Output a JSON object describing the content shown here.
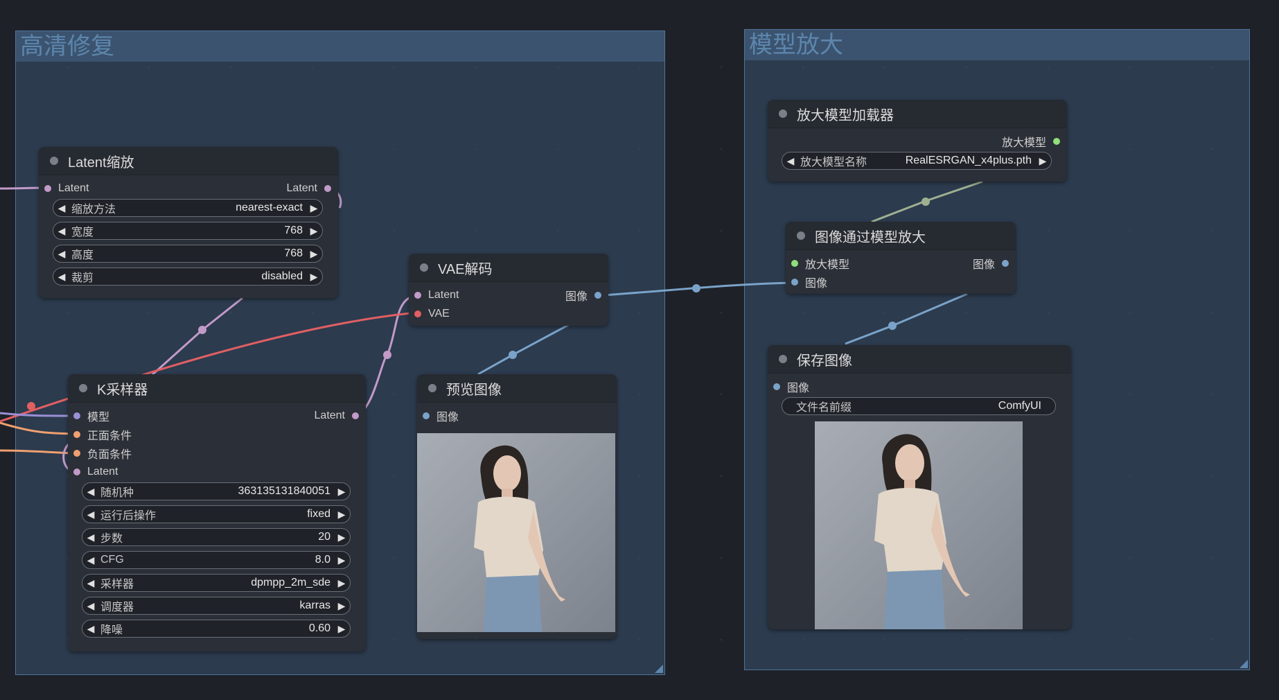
{
  "groups": {
    "hires": {
      "title": "高清修复"
    },
    "upscale": {
      "title": "模型放大"
    }
  },
  "latent_scale": {
    "title": "Latent缩放",
    "input": "Latent",
    "output": "Latent",
    "widgets": [
      {
        "label": "缩放方法",
        "value": "nearest-exact"
      },
      {
        "label": "宽度",
        "value": "768"
      },
      {
        "label": "高度",
        "value": "768"
      },
      {
        "label": "裁剪",
        "value": "disabled"
      }
    ]
  },
  "vae_decode": {
    "title": "VAE解码",
    "inputs": [
      "Latent",
      "VAE"
    ],
    "output": "图像"
  },
  "ksampler": {
    "title": "K采样器",
    "inputs": [
      "模型",
      "正面条件",
      "负面条件",
      "Latent"
    ],
    "output": "Latent",
    "widgets": [
      {
        "label": "随机种",
        "value": "363135131840051"
      },
      {
        "label": "运行后操作",
        "value": "fixed"
      },
      {
        "label": "步数",
        "value": "20"
      },
      {
        "label": "CFG",
        "value": "8.0"
      },
      {
        "label": "采样器",
        "value": "dpmpp_2m_sde"
      },
      {
        "label": "调度器",
        "value": "karras"
      },
      {
        "label": "降噪",
        "value": "0.60"
      }
    ]
  },
  "preview_image": {
    "title": "预览图像",
    "input": "图像"
  },
  "upscale_loader": {
    "title": "放大模型加载器",
    "output": "放大模型",
    "widget": {
      "label": "放大模型名称",
      "value": "RealESRGAN_x4plus.pth"
    }
  },
  "upscale_with_model": {
    "title": "图像通过模型放大",
    "inputs": [
      "放大模型",
      "图像"
    ],
    "output": "图像"
  },
  "save_image": {
    "title": "保存图像",
    "input": "图像",
    "widget": {
      "label": "文件名前缀",
      "value": "ComfyUI"
    }
  },
  "colors": {
    "latent": "#c29ac8",
    "vae": "#e05f63",
    "image": "#7aa3c9",
    "upscale_model": "#8fe07c",
    "model": "#9b8fd6",
    "conditioning": "#f0a070"
  }
}
